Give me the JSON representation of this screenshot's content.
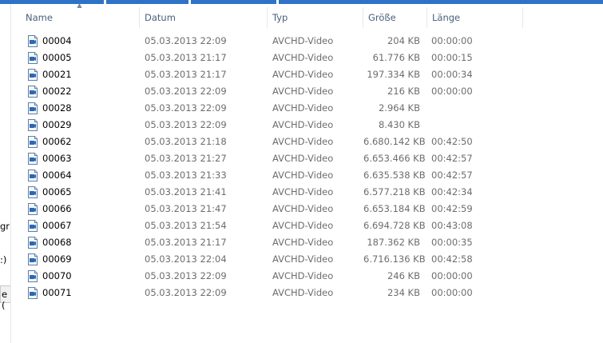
{
  "colors": {
    "accent": "#2e73c7",
    "header_text": "#4c607a",
    "muted_text": "#6d6d6d"
  },
  "sort_indicator": "up-arrow",
  "nav_fragments": [
    "gr",
    ":)",
    "e ("
  ],
  "header": {
    "name": "Name",
    "datum": "Datum",
    "typ": "Typ",
    "size": "Größe",
    "length": "Länge"
  },
  "file_icon": "video-file-icon",
  "files": [
    {
      "name": "00004",
      "datum": "05.03.2013 22:09",
      "typ": "AVCHD-Video",
      "size": "204 KB",
      "length": "00:00:00"
    },
    {
      "name": "00005",
      "datum": "05.03.2013 21:17",
      "typ": "AVCHD-Video",
      "size": "61.776 KB",
      "length": "00:00:15"
    },
    {
      "name": "00021",
      "datum": "05.03.2013 21:17",
      "typ": "AVCHD-Video",
      "size": "197.334 KB",
      "length": "00:00:34"
    },
    {
      "name": "00022",
      "datum": "05.03.2013 22:09",
      "typ": "AVCHD-Video",
      "size": "216 KB",
      "length": "00:00:00"
    },
    {
      "name": "00028",
      "datum": "05.03.2013 22:09",
      "typ": "AVCHD-Video",
      "size": "2.964 KB",
      "length": ""
    },
    {
      "name": "00029",
      "datum": "05.03.2013 22:09",
      "typ": "AVCHD-Video",
      "size": "8.430 KB",
      "length": ""
    },
    {
      "name": "00062",
      "datum": "05.03.2013 21:18",
      "typ": "AVCHD-Video",
      "size": "6.680.142 KB",
      "length": "00:42:50"
    },
    {
      "name": "00063",
      "datum": "05.03.2013 21:27",
      "typ": "AVCHD-Video",
      "size": "6.653.466 KB",
      "length": "00:42:57"
    },
    {
      "name": "00064",
      "datum": "05.03.2013 21:33",
      "typ": "AVCHD-Video",
      "size": "6.635.538 KB",
      "length": "00:42:57"
    },
    {
      "name": "00065",
      "datum": "05.03.2013 21:41",
      "typ": "AVCHD-Video",
      "size": "6.577.218 KB",
      "length": "00:42:34"
    },
    {
      "name": "00066",
      "datum": "05.03.2013 21:47",
      "typ": "AVCHD-Video",
      "size": "6.653.184 KB",
      "length": "00:42:59"
    },
    {
      "name": "00067",
      "datum": "05.03.2013 21:54",
      "typ": "AVCHD-Video",
      "size": "6.694.728 KB",
      "length": "00:43:08"
    },
    {
      "name": "00068",
      "datum": "05.03.2013 21:17",
      "typ": "AVCHD-Video",
      "size": "187.362 KB",
      "length": "00:00:35"
    },
    {
      "name": "00069",
      "datum": "05.03.2013 22:04",
      "typ": "AVCHD-Video",
      "size": "6.716.136 KB",
      "length": "00:42:58"
    },
    {
      "name": "00070",
      "datum": "05.03.2013 22:09",
      "typ": "AVCHD-Video",
      "size": "246 KB",
      "length": "00:00:00"
    },
    {
      "name": "00071",
      "datum": "05.03.2013 22:09",
      "typ": "AVCHD-Video",
      "size": "234 KB",
      "length": "00:00:00"
    }
  ]
}
